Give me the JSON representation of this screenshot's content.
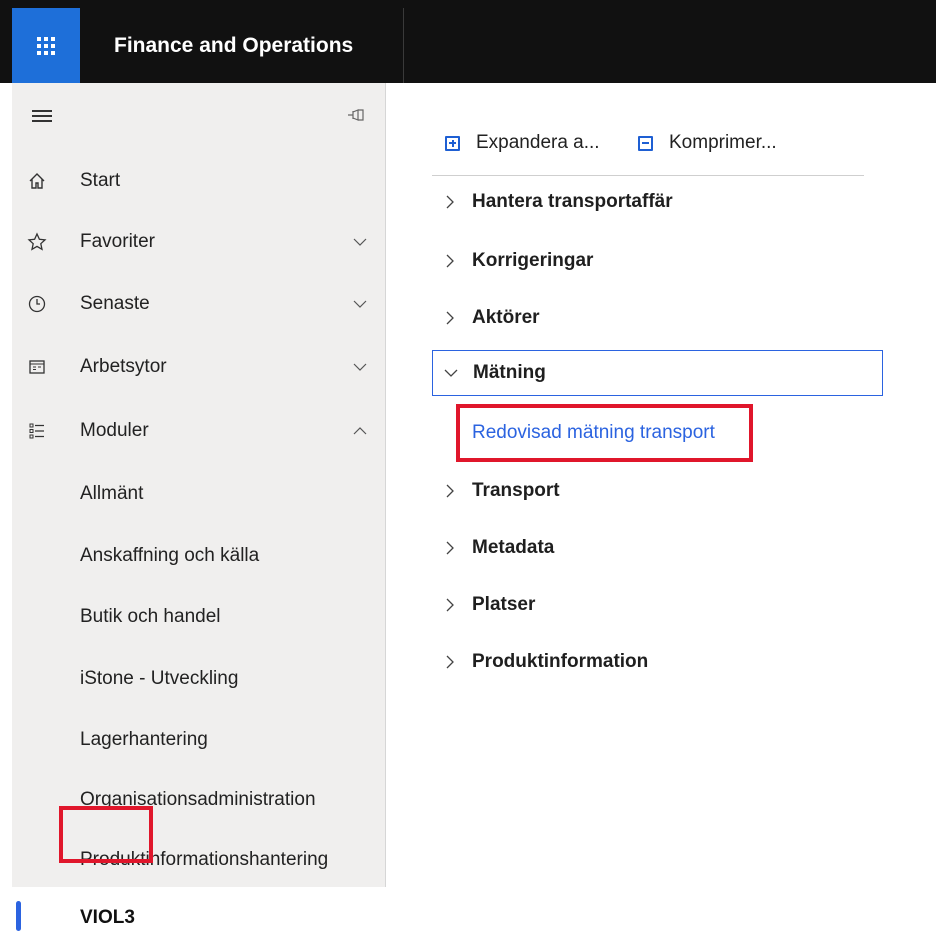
{
  "header": {
    "app_title": "Finance and Operations",
    "waffle_icon": "waffle-icon"
  },
  "sidebar": {
    "top_items": [
      {
        "label": "Start",
        "icon": "home-icon"
      },
      {
        "label": "Favoriter",
        "icon": "star-icon",
        "chevron": "down"
      },
      {
        "label": "Senaste",
        "icon": "clock-icon",
        "chevron": "down"
      },
      {
        "label": "Arbetsytor",
        "icon": "workspace-icon",
        "chevron": "down"
      },
      {
        "label": "Moduler",
        "icon": "modules-list-icon",
        "chevron": "up"
      }
    ],
    "modules": [
      "Allmänt",
      "Anskaffning och källa",
      "Butik och handel",
      "iStone - Utveckling",
      "Lagerhantering",
      "Organisationsadministration",
      "Produktinformationshantering",
      "VIOL3"
    ]
  },
  "main": {
    "toolbar": {
      "expand_label": "Expandera a...",
      "collapse_label": "Komprimer..."
    },
    "groups": [
      {
        "label": "Hantera transportaffär",
        "expanded": false
      },
      {
        "label": "Korrigeringar",
        "expanded": false
      },
      {
        "label": "Aktörer",
        "expanded": false
      },
      {
        "label": "Mätning",
        "expanded": true
      },
      {
        "label": "Transport",
        "expanded": false
      },
      {
        "label": "Metadata",
        "expanded": false
      },
      {
        "label": "Platser",
        "expanded": false
      },
      {
        "label": "Produktinformation",
        "expanded": false
      }
    ],
    "link_label": "Redovisad mätning transport"
  },
  "colors": {
    "accent": "#2b63e0",
    "highlight": "#e0162b",
    "topbar": "#111111",
    "sidebar_bg": "#f0efee"
  }
}
